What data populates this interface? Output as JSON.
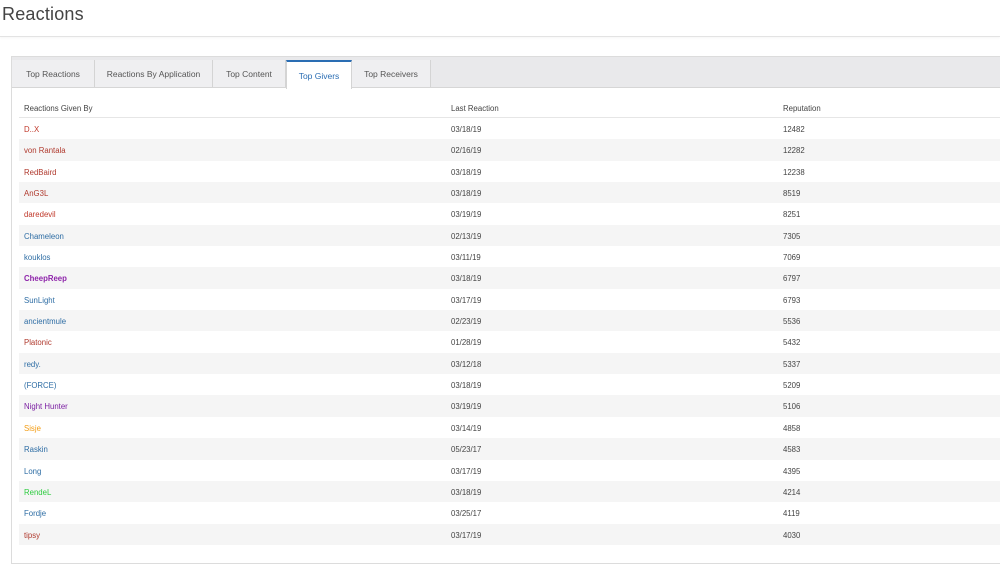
{
  "page": {
    "title": "Reactions"
  },
  "tabs": [
    {
      "label": "Top Reactions",
      "active": false
    },
    {
      "label": "Reactions By Application",
      "active": false
    },
    {
      "label": "Top Content",
      "active": false
    },
    {
      "label": "Top Givers",
      "active": true
    },
    {
      "label": "Top Receivers",
      "active": false
    }
  ],
  "table": {
    "headers": {
      "user": "Reactions Given By",
      "last": "Last Reaction",
      "rep": "Reputation"
    },
    "rows": [
      {
        "user": "D..X",
        "date": "03/18/19",
        "rep": "12482",
        "color": "#c0392b",
        "bold": false
      },
      {
        "user": "von Rantala",
        "date": "02/16/19",
        "rep": "12282",
        "color": "#b03a2e",
        "bold": false
      },
      {
        "user": "RedBaird",
        "date": "03/18/19",
        "rep": "12238",
        "color": "#b03a2e",
        "bold": false
      },
      {
        "user": "AnG3L",
        "date": "03/18/19",
        "rep": "8519",
        "color": "#b03a2e",
        "bold": false
      },
      {
        "user": "daredevil",
        "date": "03/19/19",
        "rep": "8251",
        "color": "#c0392b",
        "bold": false
      },
      {
        "user": "Chameleon",
        "date": "02/13/19",
        "rep": "7305",
        "color": "#2e6da4",
        "bold": false
      },
      {
        "user": "kouklos",
        "date": "03/11/19",
        "rep": "7069",
        "color": "#2e6da4",
        "bold": false
      },
      {
        "user": "CheepReep",
        "date": "03/18/19",
        "rep": "6797",
        "color": "#8e24aa",
        "bold": true
      },
      {
        "user": "SunLight",
        "date": "03/17/19",
        "rep": "6793",
        "color": "#2e6da4",
        "bold": false
      },
      {
        "user": "ancientmule",
        "date": "02/23/19",
        "rep": "5536",
        "color": "#2e6da4",
        "bold": false
      },
      {
        "user": "Platonic",
        "date": "01/28/19",
        "rep": "5432",
        "color": "#b03a2e",
        "bold": false
      },
      {
        "user": "redy.",
        "date": "03/12/18",
        "rep": "5337",
        "color": "#2e6da4",
        "bold": false
      },
      {
        "user": "(FORCE)",
        "date": "03/18/19",
        "rep": "5209",
        "color": "#2e6da4",
        "bold": false
      },
      {
        "user": "Night Hunter",
        "date": "03/19/19",
        "rep": "5106",
        "color": "#7b1fa2",
        "bold": false
      },
      {
        "user": "Sisje",
        "date": "03/14/19",
        "rep": "4858",
        "color": "#f39c12",
        "bold": false
      },
      {
        "user": "Raskin",
        "date": "05/23/17",
        "rep": "4583",
        "color": "#2e6da4",
        "bold": false
      },
      {
        "user": "Long",
        "date": "03/17/19",
        "rep": "4395",
        "color": "#2e6da4",
        "bold": false
      },
      {
        "user": "RendeL",
        "date": "03/18/19",
        "rep": "4214",
        "color": "#2ecc40",
        "bold": false
      },
      {
        "user": "Fordje",
        "date": "03/25/17",
        "rep": "4119",
        "color": "#2e6da4",
        "bold": false
      },
      {
        "user": "tipsy",
        "date": "03/17/19",
        "rep": "4030",
        "color": "#b03a2e",
        "bold": false
      }
    ]
  }
}
